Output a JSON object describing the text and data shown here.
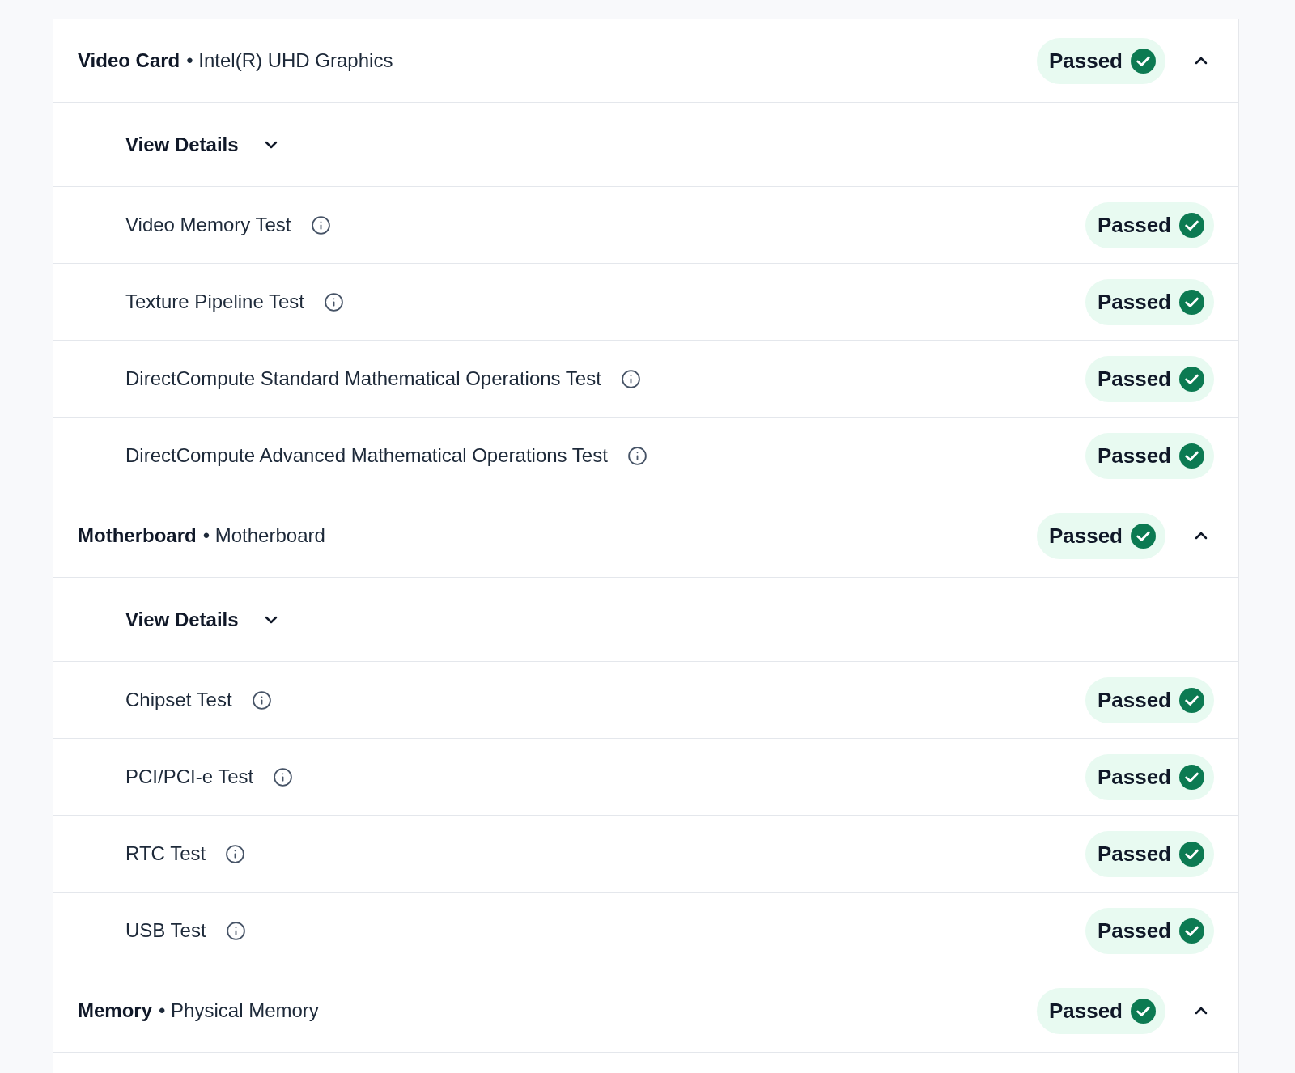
{
  "sections": [
    {
      "title": "Video Card",
      "subtitle": "• Intel(R) UHD Graphics",
      "status": "Passed",
      "expanded": true,
      "details_label": "View Details",
      "details_expanded": false,
      "tests": [
        {
          "name": "Video Memory Test",
          "status": "Passed"
        },
        {
          "name": "Texture Pipeline Test",
          "status": "Passed"
        },
        {
          "name": "DirectCompute Standard Mathematical Operations Test",
          "status": "Passed"
        },
        {
          "name": "DirectCompute Advanced Mathematical Operations Test",
          "status": "Passed"
        }
      ]
    },
    {
      "title": "Motherboard",
      "subtitle": "• Motherboard",
      "status": "Passed",
      "expanded": true,
      "details_label": "View Details",
      "details_expanded": false,
      "tests": [
        {
          "name": "Chipset Test",
          "status": "Passed"
        },
        {
          "name": "PCI/PCI-e Test",
          "status": "Passed"
        },
        {
          "name": "RTC Test",
          "status": "Passed"
        },
        {
          "name": "USB Test",
          "status": "Passed"
        }
      ]
    },
    {
      "title": "Memory",
      "subtitle": "• Physical Memory",
      "status": "Passed",
      "expanded": true
    }
  ]
}
